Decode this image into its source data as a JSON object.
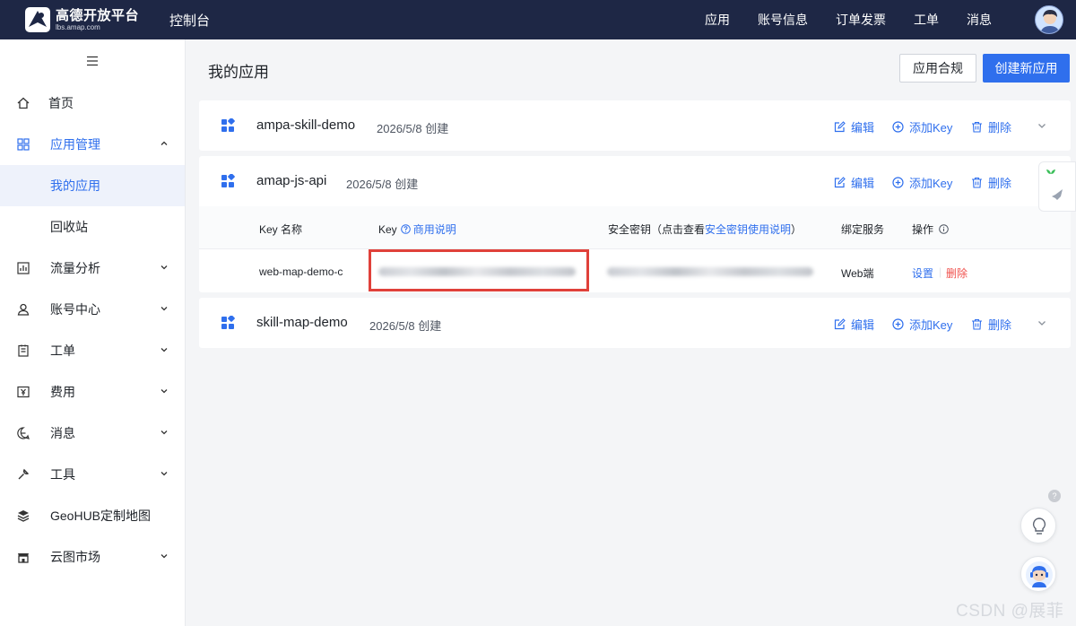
{
  "topbar": {
    "brand_name": "高德开放平台",
    "brand_url": "lbs.amap.com",
    "console_title": "控制台",
    "nav": [
      "应用",
      "账号信息",
      "订单发票",
      "工单",
      "消息"
    ]
  },
  "sidebar": {
    "toggle_icon": "menu-icon",
    "items": [
      {
        "label": "首页",
        "icon": "home-icon"
      },
      {
        "label": "应用管理",
        "icon": "grid-icon"
      },
      {
        "label": "我的应用"
      },
      {
        "label": "回收站"
      },
      {
        "label": "流量分析",
        "icon": "chart-icon"
      },
      {
        "label": "账号中心",
        "icon": "user-icon"
      },
      {
        "label": "工单",
        "icon": "ticket-icon"
      },
      {
        "label": "费用",
        "icon": "yen-icon"
      },
      {
        "label": "消息",
        "icon": "message-icon"
      },
      {
        "label": "工具",
        "icon": "wrench-icon"
      },
      {
        "label": "GeoHUB定制地图",
        "icon": "layers-icon"
      },
      {
        "label": "云图市场",
        "icon": "store-icon"
      }
    ]
  },
  "main": {
    "title": "我的应用",
    "compliance_button": "应用合规",
    "create_button": "创建新应用",
    "actions": {
      "edit": "编辑",
      "add_key": "添加Key",
      "delete": "删除"
    },
    "apps": [
      {
        "name": "ampa-skill-demo",
        "date": "2026/5/8 创建"
      },
      {
        "name": "amap-js-api",
        "date": "2026/5/8 创建"
      },
      {
        "name": "skill-map-demo",
        "date": "2026/5/8 创建"
      }
    ],
    "key_table": {
      "col_name": "Key 名称",
      "col_key": "Key",
      "col_key_link": "商用说明",
      "col_secret": "安全密钥（点击查看",
      "col_secret_link": "安全密钥使用说明",
      "col_secret_end": "）",
      "col_service": "绑定服务",
      "col_ops": "操作",
      "rows": [
        {
          "name": "web-map-demo-c",
          "service": "Web端",
          "op_settings": "设置",
          "op_delete": "删除"
        }
      ]
    }
  },
  "watermark": "CSDN @展菲",
  "colors": {
    "primary": "#2f6fed",
    "topbar": "#1e2745",
    "danger": "#f0504c",
    "highlight": "#e0413a"
  }
}
